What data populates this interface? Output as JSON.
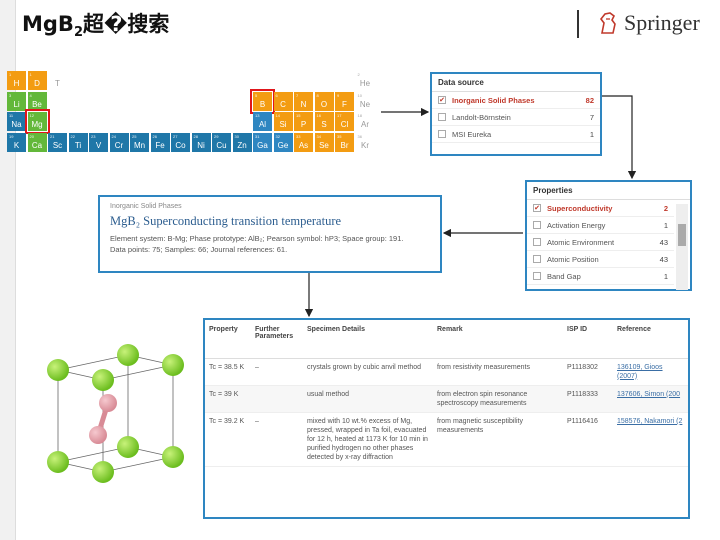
{
  "title_main": "MgB",
  "title_sub": "2",
  "title_rest": "超�搜索",
  "publisher": "Springer",
  "periodic_table": {
    "rows": [
      [
        {
          "sym": "H",
          "n": "1",
          "c": "orange"
        },
        {
          "sym": "D",
          "n": "1",
          "c": "orange"
        },
        {
          "sym": "T",
          "n": "",
          "c": "white"
        },
        {
          "sym": "",
          "n": "",
          "c": "none"
        },
        {
          "sym": "",
          "n": "",
          "c": "none"
        },
        {
          "sym": "",
          "n": "",
          "c": "none"
        },
        {
          "sym": "",
          "n": "",
          "c": "none"
        },
        {
          "sym": "",
          "n": "",
          "c": "none"
        },
        {
          "sym": "",
          "n": "",
          "c": "none"
        },
        {
          "sym": "",
          "n": "",
          "c": "none"
        },
        {
          "sym": "",
          "n": "",
          "c": "none"
        },
        {
          "sym": "",
          "n": "",
          "c": "none"
        },
        {
          "sym": "",
          "n": "",
          "c": "none"
        },
        {
          "sym": "",
          "n": "",
          "c": "none"
        },
        {
          "sym": "",
          "n": "",
          "c": "none"
        },
        {
          "sym": "",
          "n": "",
          "c": "none"
        },
        {
          "sym": "",
          "n": "",
          "c": "none"
        },
        {
          "sym": "He",
          "n": "2",
          "c": "white"
        }
      ],
      [
        {
          "sym": "Li",
          "n": "3",
          "c": "green"
        },
        {
          "sym": "Be",
          "n": "4",
          "c": "green"
        },
        {
          "sym": "",
          "n": "",
          "c": "none"
        },
        {
          "sym": "",
          "n": "",
          "c": "none"
        },
        {
          "sym": "",
          "n": "",
          "c": "none"
        },
        {
          "sym": "",
          "n": "",
          "c": "none"
        },
        {
          "sym": "",
          "n": "",
          "c": "none"
        },
        {
          "sym": "",
          "n": "",
          "c": "none"
        },
        {
          "sym": "",
          "n": "",
          "c": "none"
        },
        {
          "sym": "",
          "n": "",
          "c": "none"
        },
        {
          "sym": "",
          "n": "",
          "c": "none"
        },
        {
          "sym": "",
          "n": "",
          "c": "none"
        },
        {
          "sym": "B",
          "n": "5",
          "c": "orange",
          "sel": true
        },
        {
          "sym": "C",
          "n": "6",
          "c": "orange"
        },
        {
          "sym": "N",
          "n": "7",
          "c": "orange"
        },
        {
          "sym": "O",
          "n": "8",
          "c": "orange"
        },
        {
          "sym": "F",
          "n": "9",
          "c": "orange"
        },
        {
          "sym": "Ne",
          "n": "10",
          "c": "white"
        }
      ],
      [
        {
          "sym": "Na",
          "n": "11",
          "c": "teal"
        },
        {
          "sym": "Mg",
          "n": "12",
          "c": "green",
          "sel": true
        },
        {
          "sym": "",
          "n": "",
          "c": "none"
        },
        {
          "sym": "",
          "n": "",
          "c": "none"
        },
        {
          "sym": "",
          "n": "",
          "c": "none"
        },
        {
          "sym": "",
          "n": "",
          "c": "none"
        },
        {
          "sym": "",
          "n": "",
          "c": "none"
        },
        {
          "sym": "",
          "n": "",
          "c": "none"
        },
        {
          "sym": "",
          "n": "",
          "c": "none"
        },
        {
          "sym": "",
          "n": "",
          "c": "none"
        },
        {
          "sym": "",
          "n": "",
          "c": "none"
        },
        {
          "sym": "",
          "n": "",
          "c": "none"
        },
        {
          "sym": "Al",
          "n": "13",
          "c": "blue"
        },
        {
          "sym": "Si",
          "n": "14",
          "c": "orange"
        },
        {
          "sym": "P",
          "n": "15",
          "c": "orange"
        },
        {
          "sym": "S",
          "n": "16",
          "c": "orange"
        },
        {
          "sym": "Cl",
          "n": "17",
          "c": "orange"
        },
        {
          "sym": "Ar",
          "n": "18",
          "c": "white"
        }
      ],
      [
        {
          "sym": "K",
          "n": "19",
          "c": "teal"
        },
        {
          "sym": "Ca",
          "n": "20",
          "c": "green"
        },
        {
          "sym": "Sc",
          "n": "21",
          "c": "teal"
        },
        {
          "sym": "Ti",
          "n": "22",
          "c": "teal"
        },
        {
          "sym": "V",
          "n": "23",
          "c": "teal"
        },
        {
          "sym": "Cr",
          "n": "24",
          "c": "teal"
        },
        {
          "sym": "Mn",
          "n": "25",
          "c": "teal"
        },
        {
          "sym": "Fe",
          "n": "26",
          "c": "teal"
        },
        {
          "sym": "Co",
          "n": "27",
          "c": "teal"
        },
        {
          "sym": "Ni",
          "n": "28",
          "c": "teal"
        },
        {
          "sym": "Cu",
          "n": "29",
          "c": "teal"
        },
        {
          "sym": "Zn",
          "n": "30",
          "c": "teal"
        },
        {
          "sym": "Ga",
          "n": "31",
          "c": "blue"
        },
        {
          "sym": "Ge",
          "n": "32",
          "c": "blue"
        },
        {
          "sym": "As",
          "n": "33",
          "c": "orange"
        },
        {
          "sym": "Se",
          "n": "34",
          "c": "orange"
        },
        {
          "sym": "Br",
          "n": "35",
          "c": "orange"
        },
        {
          "sym": "Kr",
          "n": "36",
          "c": "white"
        }
      ]
    ]
  },
  "data_source": {
    "header": "Data source",
    "items": [
      {
        "label": "Inorganic Solid Phases",
        "count": "82",
        "checked": true
      },
      {
        "label": "Landolt-Börnstein",
        "count": "7",
        "checked": false
      },
      {
        "label": "MSI Eureka",
        "count": "1",
        "checked": false
      }
    ]
  },
  "properties": {
    "header": "Properties",
    "items": [
      {
        "label": "Superconductivity",
        "count": "2",
        "checked": true
      },
      {
        "label": "Activation Energy",
        "count": "1",
        "checked": false
      },
      {
        "label": "Atomic Environment",
        "count": "43",
        "checked": false
      },
      {
        "label": "Atomic Position",
        "count": "43",
        "checked": false
      },
      {
        "label": "Band Gap",
        "count": "1",
        "checked": false
      }
    ]
  },
  "summary": {
    "source": "Inorganic Solid Phases",
    "title": "MgB₂ Superconducting transition temperature",
    "line1": "Element system: B-Mg; Phase prototype: AlB₂; Pearson symbol: hP3; Space group: 191.",
    "line2": "Data points: 75; Samples: 66; Journal references: 61."
  },
  "specimen_table": {
    "headers": [
      "Property",
      "Further Parameters",
      "Specimen Details",
      "Remark",
      "ISP ID",
      "Reference"
    ],
    "rows": [
      [
        "Tc = 38.5 K",
        "–",
        "crystals grown by cubic anvil method",
        "from resistivity measurements",
        "P1118302",
        "136109, Gioos (2007)"
      ],
      [
        "Tc = 39 K",
        "",
        "usual method",
        "from electron spin resonance spectroscopy measurements",
        "P1118333",
        "137606, Simon (200"
      ],
      [
        "Tc = 39.2 K",
        "–",
        "mixed with 10 wt.% excess of Mg, pressed, wrapped in Ta foil, evacuated for 12 h, heated at 1173 K for 10 min in purified hydrogen no other phases detected by x-ray diffraction",
        "from magnetic susceptibility measurements",
        "P1116416",
        "158576, Nakamori (2"
      ]
    ]
  }
}
